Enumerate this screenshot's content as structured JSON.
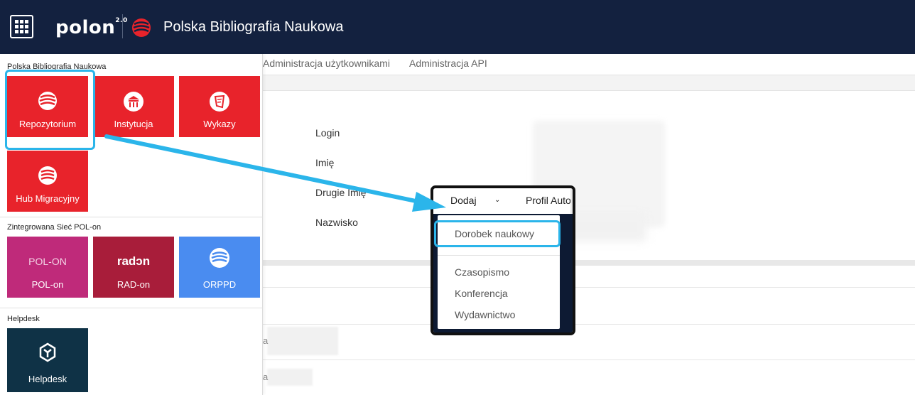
{
  "header": {
    "brand": "polon",
    "brand_version": "2.0",
    "app_title": "Polska Bibliografia Naukowa"
  },
  "subnav": {
    "items": [
      "Administracja użytkownikami",
      "Administracja API"
    ]
  },
  "profile_fields": [
    "Login",
    "Imię",
    "Drugie Imię",
    "Nazwisko"
  ],
  "table_partial": [
    "a",
    "a"
  ],
  "menu": {
    "sections": [
      {
        "title": "Polska Bibliografia Naukowa",
        "tiles": [
          "Repozytorium",
          "Instytucja",
          "Wykazy",
          "Hub Migracyjny"
        ]
      },
      {
        "title": "Zintegrowana Sieć POL-on",
        "tiles": [
          "POL-on",
          "RAD-on",
          "ORPPD"
        ],
        "logos": {
          "polon": "POL-ON",
          "radon": "radɔn"
        }
      },
      {
        "title": "Helpdesk",
        "tiles": [
          "Helpdesk"
        ]
      }
    ]
  },
  "dropdown": {
    "trigger_label": "Dodaj",
    "neighbor_label": "Profil Autora",
    "items": [
      "Dorobek naukowy",
      "Czasopismo",
      "Konferencja",
      "Wydawnictwo"
    ]
  },
  "colors": {
    "topbar": "#13213f",
    "pbn_red": "#e8232b",
    "polon_magenta": "#bf2a7a",
    "radon_crimson": "#a81d3a",
    "orppd_blue": "#4a8cf0",
    "helpdesk_navy": "#0f3246",
    "highlight": "#2bb5ea"
  },
  "icons": [
    "apps-grid-icon",
    "pbn-logo-icon",
    "repozytorium-icon",
    "institution-icon",
    "wykazy-icon",
    "hub-icon",
    "orppd-icon",
    "helpdesk-icon",
    "chevron-down-icon"
  ]
}
